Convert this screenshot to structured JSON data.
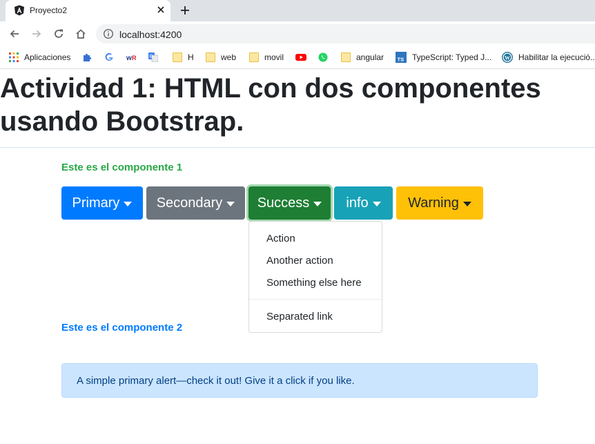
{
  "browser": {
    "tab": {
      "title": "Proyecto2"
    },
    "address_bar": {
      "url": "localhost:4200"
    },
    "bookmarks": [
      {
        "label": "Aplicaciones",
        "icon": "apps-grid-icon"
      },
      {
        "label": "",
        "icon": "puzzle-extension-icon"
      },
      {
        "label": "",
        "icon": "google-icon"
      },
      {
        "label": "",
        "icon": "wordreference-icon"
      },
      {
        "label": "",
        "icon": "google-translate-icon"
      },
      {
        "label": "H",
        "icon": "folder-icon"
      },
      {
        "label": "web",
        "icon": "folder-icon"
      },
      {
        "label": "movil",
        "icon": "folder-icon"
      },
      {
        "label": "",
        "icon": "youtube-icon"
      },
      {
        "label": "",
        "icon": "whatsapp-icon"
      },
      {
        "label": "angular",
        "icon": "folder-icon"
      },
      {
        "label": "TypeScript: Typed J...",
        "icon": "typescript-icon"
      },
      {
        "label": "Habilitar la ejecució...",
        "icon": "wordpress-icon"
      }
    ]
  },
  "page": {
    "title": "Actividad 1: HTML con dos componentes usando Bootstrap.",
    "component1": {
      "title": "Este es el componente 1",
      "buttons": [
        {
          "label": "Primary",
          "color": "#007bff"
        },
        {
          "label": "Secondary",
          "color": "#6c757d"
        },
        {
          "label": "Success",
          "color": "#1e7e34"
        },
        {
          "label": "info",
          "color": "#17a2b8"
        },
        {
          "label": "Warning",
          "color": "#ffc107"
        }
      ],
      "dropdown_menu": {
        "items": [
          "Action",
          "Another action",
          "Something else here"
        ],
        "separated_item": "Separated link"
      }
    },
    "component2": {
      "title": "Este es el componente 2",
      "alert": {
        "text": "A simple primary alert—check it out! Give it a click if you like.",
        "color": "#cce5ff"
      }
    }
  }
}
